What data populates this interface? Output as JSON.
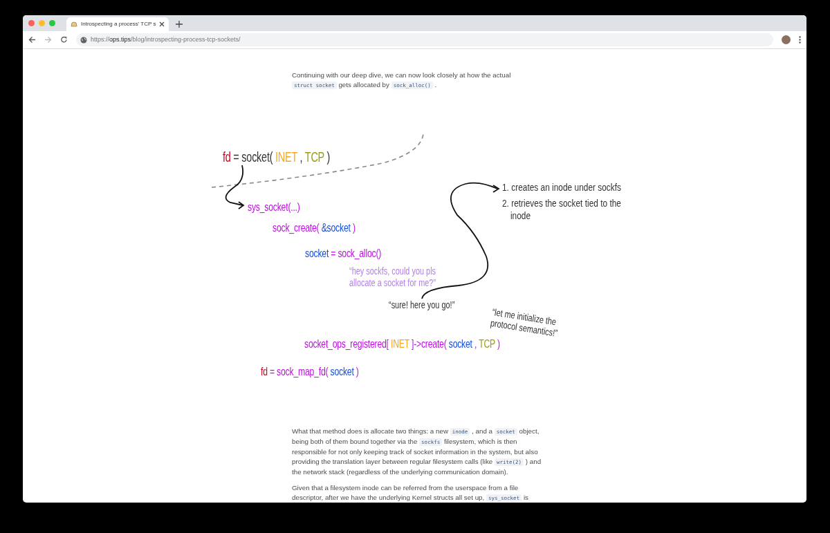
{
  "browser": {
    "tab_title": "Introspecting a process' TCP s",
    "url": {
      "scheme": "https://",
      "host": "ops.tips",
      "path": "/blog/introspecting-process-tcp-sockets/"
    }
  },
  "paragraphs_top": [
    [
      {
        "kind": "text",
        "text": "Continuing with our deep dive, we can now look closely at how the actual "
      },
      {
        "kind": "code",
        "text": "struct socket"
      },
      {
        "kind": "text",
        "text": " gets allocated by "
      },
      {
        "kind": "code",
        "text": "sock_alloc()"
      },
      {
        "kind": "text",
        "text": " ."
      }
    ]
  ],
  "diagram": {
    "lines": [
      {
        "kind": "code",
        "color": "#333333",
        "parts": [
          {
            "text": "fd",
            "color": "#d0021b"
          },
          {
            "text": " = socket( "
          },
          {
            "text": "INET",
            "color": "#f5a623"
          },
          {
            "text": " , "
          },
          {
            "text": "TCP",
            "color": "#9b9b10"
          },
          {
            "text": " )"
          }
        ]
      },
      {
        "kind": "code",
        "parts": [
          {
            "text": "sys_socket(...)",
            "color": "#bd10e0"
          }
        ]
      },
      {
        "kind": "code",
        "color": "#bd10e0",
        "parts": [
          {
            "text": "sock_create( "
          },
          {
            "text": "&socket",
            "color": "#1a4fd6"
          },
          {
            "text": " )"
          }
        ]
      },
      {
        "kind": "code",
        "parts": [
          {
            "text": "socket",
            "color": "#1a4fd6"
          },
          {
            "text": " = sock_alloc()",
            "color": "#bd10e0"
          }
        ]
      },
      {
        "kind": "note",
        "parts": [
          {
            "text": "“hey sockfs, could you pls allocate a socket for me?”",
            "color": "#b57cf0"
          }
        ]
      },
      {
        "kind": "note",
        "parts": [
          {
            "text": "“sure! here you go!”",
            "color": "#333333"
          }
        ]
      },
      {
        "kind": "rotated",
        "parts": [
          {
            "text": "“let me initialize the protocol semantics!”",
            "color": "#333333"
          }
        ]
      },
      {
        "kind": "code",
        "color": "#bd10e0",
        "parts": [
          {
            "text": "socket_ops_registered[ "
          },
          {
            "text": "INET",
            "color": "#f5a623"
          },
          {
            "text": " ]->create( "
          },
          {
            "text": "socket",
            "color": "#1a4fd6"
          },
          {
            "text": " , "
          },
          {
            "text": "TCP",
            "color": "#9b9b10"
          },
          {
            "text": " )"
          }
        ]
      },
      {
        "kind": "code",
        "parts": [
          {
            "text": "fd",
            "color": "#d0021b"
          },
          {
            "text": " = sock_map_fd( ",
            "color": "#bd10e0"
          },
          {
            "text": "socket",
            "color": "#1a4fd6"
          },
          {
            "text": " )",
            "color": "#bd10e0"
          }
        ]
      }
    ],
    "steps": [
      "1. creates an inode under sockfs",
      "2. retrieves the socket tied to the inode"
    ]
  },
  "paragraphs_bottom": [
    [
      {
        "kind": "text",
        "text": "What that method does is allocate two things: a new "
      },
      {
        "kind": "code",
        "text": "inode"
      },
      {
        "kind": "text",
        "text": " , and a "
      },
      {
        "kind": "code",
        "text": "socket"
      },
      {
        "kind": "text",
        "text": " object, being both of them bound together via the "
      },
      {
        "kind": "code",
        "text": "sockfs"
      },
      {
        "kind": "text",
        "text": " filesystem, which is then responsible for not only keeping track of socket information in the system, but also providing the translation layer between regular filesystem calls (like "
      },
      {
        "kind": "code",
        "text": "write(2)"
      },
      {
        "kind": "text",
        "text": " ) and the network stack (regardless of the underlying communication domain)."
      }
    ],
    [
      {
        "kind": "text",
        "text": "Given that a filesystem inode can be referred from the userspace from a file descriptor, after we have the underlying Kernel structs all set up, "
      },
      {
        "kind": "code",
        "text": "sys_socket"
      },
      {
        "kind": "text",
        "text": " is"
      }
    ]
  ]
}
